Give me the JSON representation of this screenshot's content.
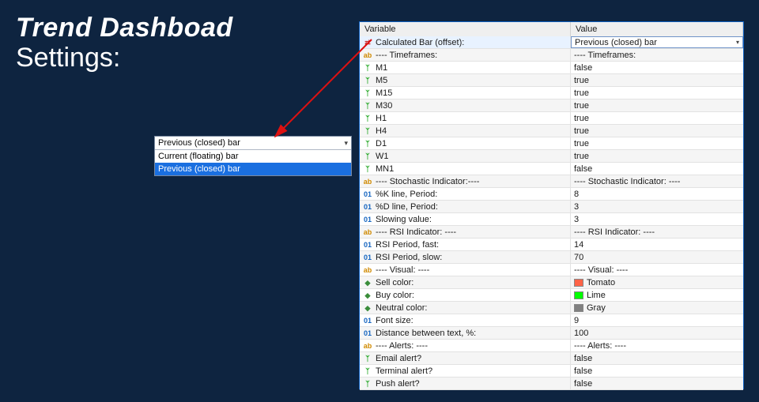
{
  "title": {
    "line1": "Trend Dashboad",
    "line2": "Settings:"
  },
  "dropdown": {
    "selected": "Previous (closed) bar",
    "options": [
      "Current (floating) bar",
      "Previous (closed) bar"
    ]
  },
  "grid": {
    "headers": {
      "var": "Variable",
      "val": "Value"
    },
    "rows": [
      {
        "type": "node",
        "var": "Calculated Bar (offset):",
        "val": "Previous (closed) bar",
        "sel": true
      },
      {
        "type": "ab",
        "var": "---- Timeframes:",
        "val": "---- Timeframes:"
      },
      {
        "type": "flag",
        "var": "M1",
        "val": "false"
      },
      {
        "type": "flag",
        "var": "M5",
        "val": "true"
      },
      {
        "type": "flag",
        "var": "M15",
        "val": "true"
      },
      {
        "type": "flag",
        "var": "M30",
        "val": "true"
      },
      {
        "type": "flag",
        "var": "H1",
        "val": "true"
      },
      {
        "type": "flag",
        "var": "H4",
        "val": "true"
      },
      {
        "type": "flag",
        "var": "D1",
        "val": "true"
      },
      {
        "type": "flag",
        "var": "W1",
        "val": "true"
      },
      {
        "type": "flag",
        "var": "MN1",
        "val": "false"
      },
      {
        "type": "ab",
        "var": "---- Stochastic Indicator:----",
        "val": "---- Stochastic Indicator: ----"
      },
      {
        "type": "num",
        "var": "%K line, Period:",
        "val": "8"
      },
      {
        "type": "num",
        "var": "%D line, Period:",
        "val": "3"
      },
      {
        "type": "num",
        "var": "Slowing value:",
        "val": "3"
      },
      {
        "type": "ab",
        "var": "---- RSI Indicator: ----",
        "val": "---- RSI Indicator: ----"
      },
      {
        "type": "num",
        "var": "RSI Period, fast:",
        "val": "14"
      },
      {
        "type": "num",
        "var": "RSI Period, slow:",
        "val": "70"
      },
      {
        "type": "ab",
        "var": "---- Visual: ----",
        "val": "---- Visual: ----"
      },
      {
        "type": "col",
        "var": "Sell color:",
        "val": "Tomato",
        "swatch": "#ff6347"
      },
      {
        "type": "col",
        "var": "Buy color:",
        "val": "Lime",
        "swatch": "#00ff00"
      },
      {
        "type": "col",
        "var": "Neutral color:",
        "val": "Gray",
        "swatch": "#808080"
      },
      {
        "type": "num",
        "var": "Font size:",
        "val": "9"
      },
      {
        "type": "num",
        "var": "Distance between text, %:",
        "val": "100"
      },
      {
        "type": "ab",
        "var": "---- Alerts: ----",
        "val": "---- Alerts: ----"
      },
      {
        "type": "flag",
        "var": "Email alert?",
        "val": "false"
      },
      {
        "type": "flag",
        "var": "Terminal alert?",
        "val": "false"
      },
      {
        "type": "flag",
        "var": "Push alert?",
        "val": "false"
      }
    ]
  },
  "icons": {
    "node": "⇄",
    "ab": "ab",
    "flag": "ᛉ",
    "num": "01",
    "col": "◆"
  }
}
